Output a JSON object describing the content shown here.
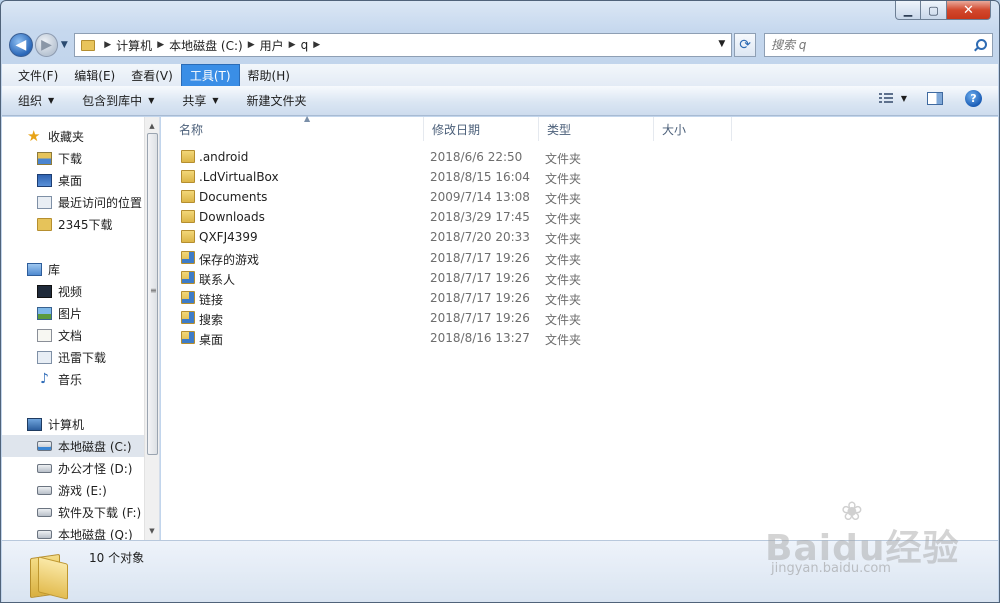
{
  "caption": {
    "minimize": "▁",
    "maximize": "▢",
    "close": "✕"
  },
  "address": {
    "crumbs": [
      "计算机",
      "本地磁盘 (C:)",
      "用户",
      "q"
    ]
  },
  "search": {
    "placeholder": "搜索 q"
  },
  "menubar": {
    "items": [
      {
        "label": "文件(F)",
        "active": false
      },
      {
        "label": "编辑(E)",
        "active": false
      },
      {
        "label": "查看(V)",
        "active": false
      },
      {
        "label": "工具(T)",
        "active": true
      },
      {
        "label": "帮助(H)",
        "active": false
      }
    ]
  },
  "toolbar": {
    "organize": "组织",
    "include_library": "包含到库中",
    "share": "共享",
    "new_folder": "新建文件夹",
    "help": "?"
  },
  "navpane": {
    "favorites_head": "收藏夹",
    "favorites": [
      "下载",
      "桌面",
      "最近访问的位置",
      "2345下载"
    ],
    "libraries_head": "库",
    "libraries": [
      "视频",
      "图片",
      "文档",
      "迅雷下载",
      "音乐"
    ],
    "computer_head": "计算机",
    "drives": [
      "本地磁盘 (C:)",
      "办公才怪 (D:)",
      "游戏 (E:)",
      "软件及下载 (F:)",
      "本地磁盘 (Q:)"
    ],
    "selected": "本地磁盘 (C:)"
  },
  "columns": {
    "name": "名称",
    "date": "修改日期",
    "type": "类型",
    "size": "大小"
  },
  "files": [
    {
      "name": ".android",
      "date": "2018/6/6 22:50",
      "type": "文件夹",
      "icon": "folder-icon"
    },
    {
      "name": ".LdVirtualBox",
      "date": "2018/8/15 16:04",
      "type": "文件夹",
      "icon": "folder-icon"
    },
    {
      "name": "Documents",
      "date": "2009/7/14 13:08",
      "type": "文件夹",
      "icon": "folder-icon"
    },
    {
      "name": "Downloads",
      "date": "2018/3/29 17:45",
      "type": "文件夹",
      "icon": "folder-icon"
    },
    {
      "name": "QXFJ4399",
      "date": "2018/7/20 20:33",
      "type": "文件夹",
      "icon": "folder-icon"
    },
    {
      "name": "保存的游戏",
      "date": "2018/7/17 19:26",
      "type": "文件夹",
      "icon": "saved-games-icon"
    },
    {
      "name": "联系人",
      "date": "2018/7/17 19:26",
      "type": "文件夹",
      "icon": "contacts-icon"
    },
    {
      "name": "链接",
      "date": "2018/7/17 19:26",
      "type": "文件夹",
      "icon": "links-icon"
    },
    {
      "name": "搜索",
      "date": "2018/7/17 19:26",
      "type": "文件夹",
      "icon": "searches-icon"
    },
    {
      "name": "桌面",
      "date": "2018/8/16 13:27",
      "type": "文件夹",
      "icon": "desktop-folder-icon"
    }
  ],
  "details": {
    "count": "10 个对象"
  },
  "watermark": {
    "text": "Baidu经验",
    "sub": "jingyan.baidu.com"
  }
}
